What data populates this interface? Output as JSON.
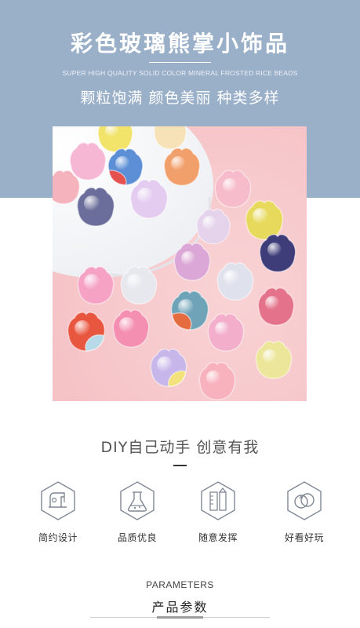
{
  "header": {
    "title": "彩色玻璃熊掌小饰品",
    "subtitle_en": "SUPER HIGH QUALITY SOLID COLOR MINERAL FROSTED RICE BEADS",
    "slogan": "颗粒饱满 颜色美丽 种类多样",
    "background_color": "#9aafc8"
  },
  "section_diy": {
    "heading": "DIY自己动手 创意有我"
  },
  "features": [
    {
      "label": "简约设计",
      "icon": "sewing-machine-icon"
    },
    {
      "label": "品质优良",
      "icon": "flask-icon"
    },
    {
      "label": "随意发挥",
      "icon": "ruler-pencil-icon"
    },
    {
      "label": "好看好玩",
      "icon": "rings-icon"
    }
  ],
  "parameters": {
    "heading_en": "PARAMETERS",
    "heading_cn": "产品参数"
  }
}
